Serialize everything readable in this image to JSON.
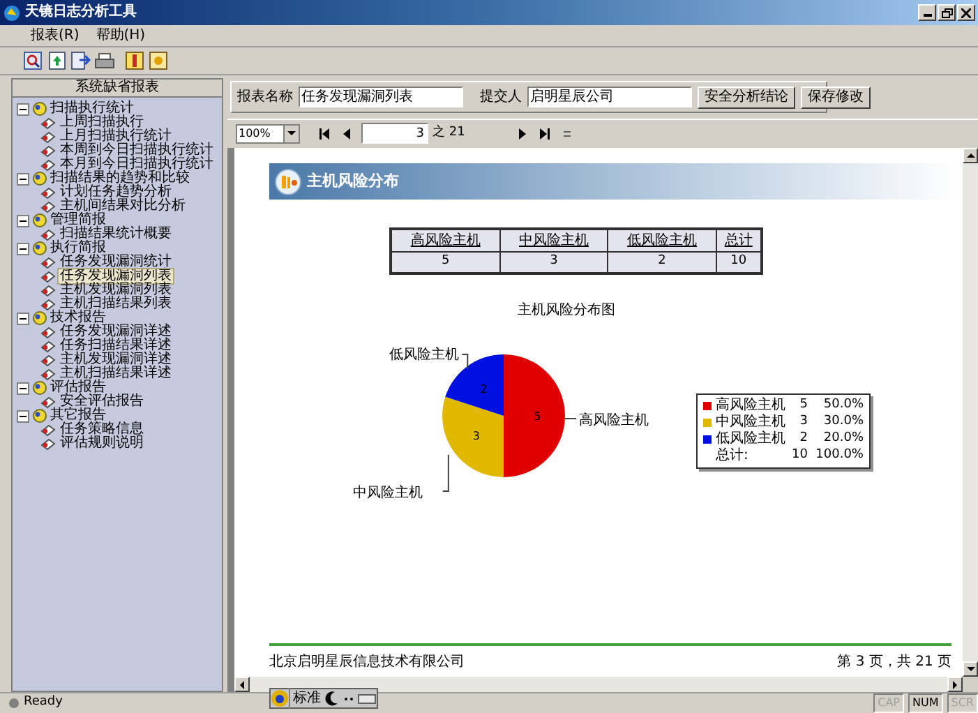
{
  "window": {
    "title": "天镜日志分析工具"
  },
  "menu": [
    "报表(R)",
    "帮助(H)"
  ],
  "sidebar": {
    "title": "系统缺省报表",
    "tree": [
      {
        "label": "扫描执行统计",
        "expanded": true,
        "children": [
          {
            "label": "上周扫描执行",
            "selected": false
          },
          {
            "label": "上月扫描执行统计",
            "selected": false
          },
          {
            "label": "本周到今日扫描执行统计",
            "selected": false
          },
          {
            "label": "本月到今日扫描执行统计",
            "selected": false
          }
        ]
      },
      {
        "label": "扫描结果的趋势和比较",
        "expanded": true,
        "children": [
          {
            "label": "计划任务趋势分析",
            "selected": false
          },
          {
            "label": "主机间结果对比分析",
            "selected": false
          }
        ]
      },
      {
        "label": "管理简报",
        "expanded": true,
        "children": [
          {
            "label": "扫描结果统计概要",
            "selected": false
          }
        ]
      },
      {
        "label": "执行简报",
        "expanded": true,
        "children": [
          {
            "label": "任务发现漏洞统计",
            "selected": false
          },
          {
            "label": "任务发现漏洞列表",
            "selected": true
          },
          {
            "label": "主机发现漏洞列表",
            "selected": false
          },
          {
            "label": "主机扫描结果列表",
            "selected": false
          }
        ]
      },
      {
        "label": "技术报告",
        "expanded": true,
        "children": [
          {
            "label": "任务发现漏洞详述",
            "selected": false
          },
          {
            "label": "任务扫描结果详述",
            "selected": false
          },
          {
            "label": "主机发现漏洞详述",
            "selected": false
          },
          {
            "label": "主机扫描结果详述",
            "selected": false
          }
        ]
      },
      {
        "label": "评估报告",
        "expanded": true,
        "children": [
          {
            "label": "安全评估报告",
            "selected": false
          }
        ]
      },
      {
        "label": "其它报告",
        "expanded": true,
        "children": [
          {
            "label": "任务策略信息",
            "selected": false
          },
          {
            "label": "评估规则说明",
            "selected": false
          }
        ]
      }
    ]
  },
  "report_form": {
    "name_label": "报表名称",
    "name_value": "任务发现漏洞列表",
    "submitter_label": "提交人",
    "submitter_value": "启明星辰公司",
    "buttons": [
      "安全分析结论",
      "保存修改"
    ]
  },
  "viewer_toolbar": {
    "zoom": "100%",
    "page": "3",
    "page_total": "之 21"
  },
  "report": {
    "section_title": "主机风险分布",
    "table": {
      "columns": [
        "高风险主机",
        "中风险主机",
        "低风险主机",
        "总计"
      ],
      "rows": [
        [
          "5",
          "3",
          "2",
          "10"
        ]
      ]
    },
    "chart": {
      "chart_data": {
        "type": "pie",
        "title": "主机风险分布图",
        "categories": [
          "高风险主机",
          "中风险主机",
          "低风险主机"
        ],
        "values": [
          5,
          3,
          2
        ],
        "data_labels": true
      },
      "legend": [
        {
          "label": "高风险主机",
          "count": "5",
          "percent": "50.0%",
          "color": "#e00000"
        },
        {
          "label": "中风险主机",
          "count": "3",
          "percent": "30.0%",
          "color": "#e0b800"
        },
        {
          "label": "低风险主机",
          "count": "2",
          "percent": "20.0%",
          "color": "#0010e0"
        }
      ],
      "legend_total": {
        "label": "总计:",
        "count": "10",
        "percent": "100.0%"
      }
    },
    "footer_left": "北京启明星辰信息技术有限公司",
    "footer_right": "第 3 页，共 21 页"
  },
  "ime": {
    "mode": "标准"
  },
  "status_bar": {
    "text": "Ready",
    "indicators": [
      {
        "label": "CAP",
        "on": false
      },
      {
        "label": "NUM",
        "on": true
      },
      {
        "label": "SCR",
        "on": false
      }
    ]
  }
}
